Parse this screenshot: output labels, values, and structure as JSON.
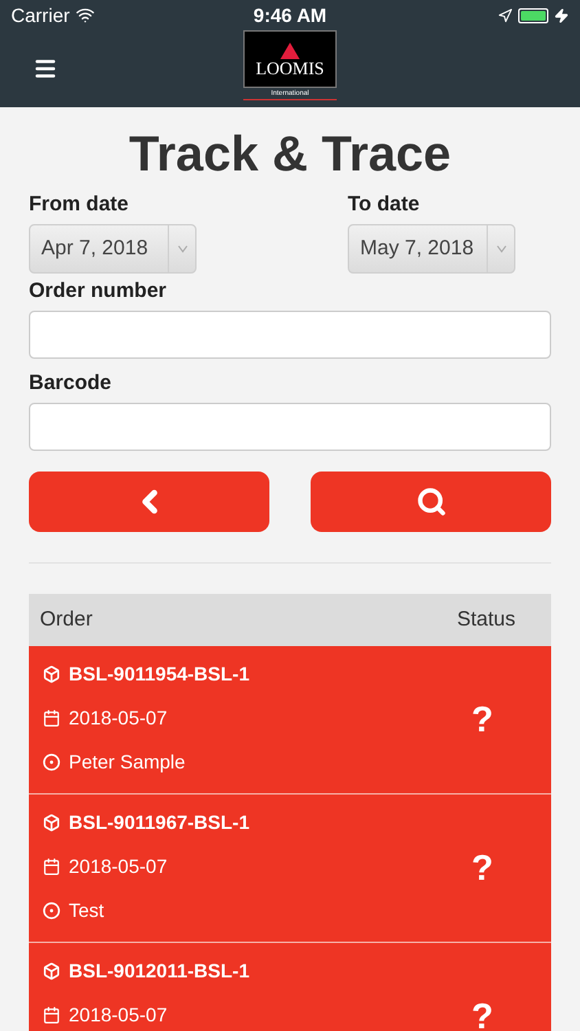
{
  "status_bar": {
    "carrier": "Carrier",
    "time": "9:46 AM"
  },
  "nav": {
    "logo_name": "LOOMIS",
    "logo_sub": "International"
  },
  "title": "Track & Trace",
  "from_date": {
    "label": "From date",
    "value": "Apr 7, 2018"
  },
  "to_date": {
    "label": "To date",
    "value": "May 7, 2018"
  },
  "order_number": {
    "label": "Order number"
  },
  "barcode": {
    "label": "Barcode"
  },
  "table": {
    "columns": [
      "Order",
      "Status"
    ],
    "rows": [
      {
        "order": "BSL-9011954-BSL-1",
        "date": "2018-05-07",
        "recipient": "Peter Sample",
        "status": "?"
      },
      {
        "order": "BSL-9011967-BSL-1",
        "date": "2018-05-07",
        "recipient": "Test",
        "status": "?"
      },
      {
        "order": "BSL-9012011-BSL-1",
        "date": "2018-05-07",
        "status": "?"
      }
    ]
  }
}
